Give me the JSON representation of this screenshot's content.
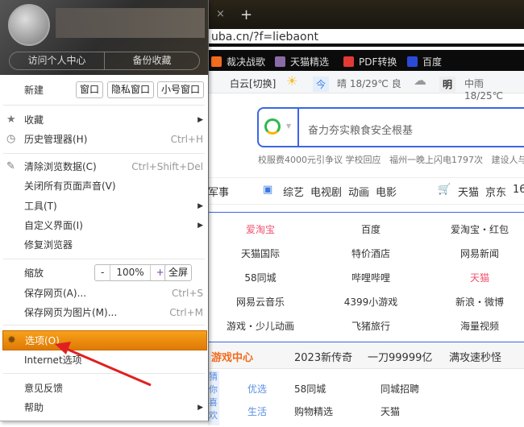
{
  "browser": {
    "tab_close": "×",
    "new_tab": "+",
    "address": "uba.cn/?f=liebaont",
    "bookmarks": [
      "裁决战歌",
      "天猫精选",
      "PDF转换",
      "百度"
    ]
  },
  "page": {
    "weather": {
      "city": "白云[切换]",
      "today_label": "今",
      "today": "晴 18/29℃ 良",
      "tomorrow_label": "明",
      "tomorrow": "中雨 18/25℃"
    },
    "search_placeholder": "奋力夯实粮食安全根基",
    "hot": [
      "校服费4000元引争议 学校回应",
      "福州一晚上闪电1797次",
      "建设人与"
    ],
    "categories": [
      "军事",
      "综艺",
      "电视剧",
      "动画",
      "电影",
      "天猫",
      "京东",
      "16"
    ],
    "links": [
      [
        "爱淘宝",
        "百度",
        "爱淘宝・红包"
      ],
      [
        "天猫国际",
        "特价酒店",
        "网易新闻"
      ],
      [
        "58同城",
        "哔哩哔哩",
        "天猫"
      ],
      [
        "网易云音乐",
        "4399小游戏",
        "新浪・微博"
      ],
      [
        "游戏・少儿动画",
        "飞猪旅行",
        "海量视频"
      ]
    ],
    "game": {
      "title": "游戏中心",
      "items": [
        "2023新传奇",
        "一刀99999亿",
        "满攻速秒怪"
      ]
    },
    "side": "猜你喜欢",
    "bottom": [
      {
        "label": "优选",
        "items": [
          "58同城",
          "同城招聘"
        ]
      },
      {
        "label": "生活",
        "items": [
          "购物精选",
          "天猫"
        ]
      }
    ]
  },
  "menu": {
    "header_buttons": [
      "访问个人中心",
      "备份收藏"
    ],
    "new_label": "新建",
    "new_buttons": [
      "窗口",
      "隐私窗口",
      "小号窗口"
    ],
    "items": [
      {
        "label": "收藏",
        "submenu": true
      },
      {
        "label": "历史管理器(H)",
        "shortcut": "Ctrl+H"
      },
      {
        "label": "清除浏览数据(C)",
        "shortcut": "Ctrl+Shift+Del"
      },
      {
        "label": "关闭所有页面声音(V)"
      },
      {
        "label": "工具(T)",
        "submenu": true
      },
      {
        "label": "自定义界面(I)",
        "submenu": true
      },
      {
        "label": "修复浏览器"
      },
      {
        "label": "保存网页(A)...",
        "shortcut": "Ctrl+S"
      },
      {
        "label": "保存网页为图片(M)...",
        "shortcut": "Ctrl+M"
      },
      {
        "label": "选项(O)"
      },
      {
        "label": "Internet选项"
      },
      {
        "label": "意见反馈"
      },
      {
        "label": "帮助",
        "submenu": true
      }
    ],
    "zoom": {
      "label": "缩放",
      "minus": "-",
      "value": "100%",
      "plus": "+",
      "fullscreen": "全屏"
    }
  },
  "colors": {
    "accent": "#f29a12",
    "link_blue": "#3a66e6",
    "annotation": "#e02020"
  }
}
